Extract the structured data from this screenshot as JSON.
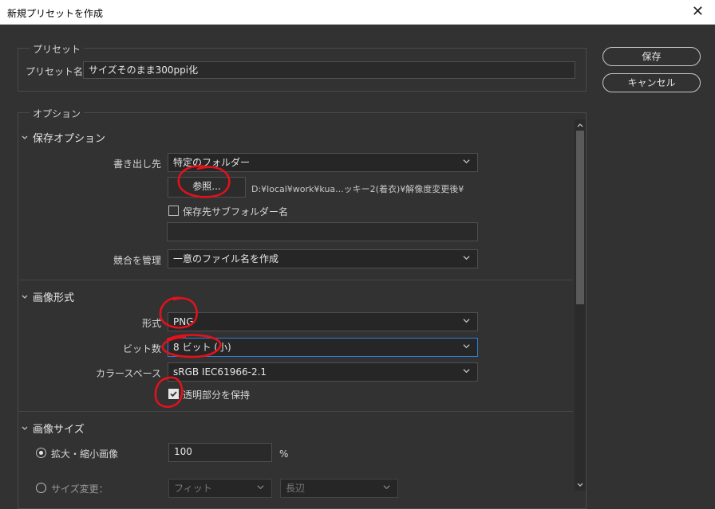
{
  "window": {
    "title": "新規プリセットを作成",
    "close_glyph": "✕"
  },
  "preset": {
    "group_label": "プリセット",
    "name_label": "プリセット名",
    "name_value": "サイズそのまま300ppi化"
  },
  "actions": {
    "save": "保存",
    "cancel": "キャンセル"
  },
  "options_group_label": "オプション",
  "save_options": {
    "header": "保存オプション",
    "dest_label": "書き出し先",
    "dest_value": "特定のフォルダー",
    "browse_label": "参照...",
    "path": "D:¥local¥work¥kua...ッキー2(着衣)¥解像度変更後¥",
    "subfolder_label": "保存先サブフォルダー名",
    "subfolder_value": "",
    "conflict_label": "競合を管理",
    "conflict_value": "一意のファイル名を作成"
  },
  "image_format": {
    "header": "画像形式",
    "format_label": "形式",
    "format_value": "PNG",
    "bitdepth_label": "ビット数",
    "bitdepth_value": "8 ビット (小)",
    "colorspace_label": "カラースペース",
    "colorspace_value": "sRGB IEC61966-2.1",
    "transparency_label": "透明部分を保持",
    "transparency_checked": true
  },
  "image_size": {
    "header": "画像サイズ",
    "scale_label": "拡大・縮小画像",
    "scale_value": "100",
    "scale_unit": "%",
    "resize_label": "サイズ変更：",
    "fit_value": "フィット",
    "edge_value": "長辺"
  },
  "colors": {
    "annotation": "#e0121c",
    "focus": "#2f7fd8",
    "background": "#323232"
  }
}
